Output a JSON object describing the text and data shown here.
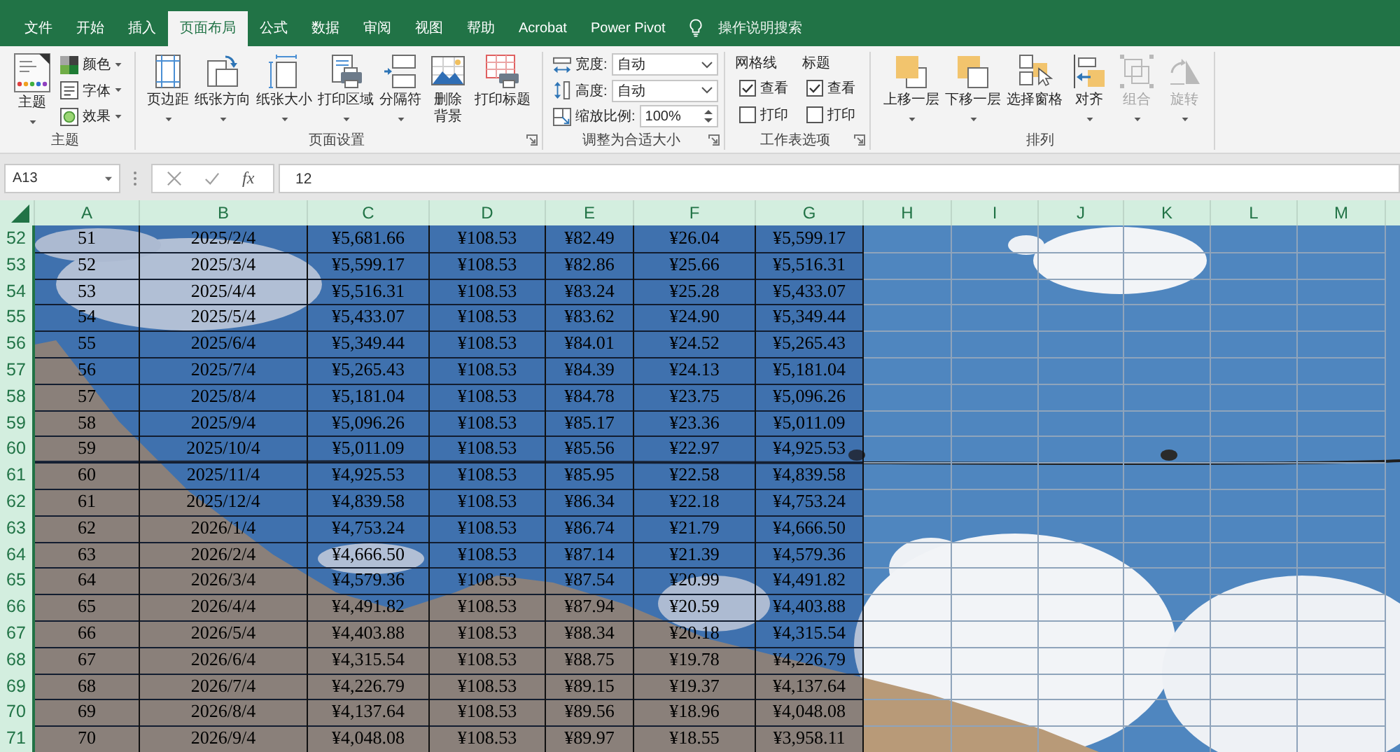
{
  "tabs": [
    {
      "label": "文件",
      "selected": false
    },
    {
      "label": "开始",
      "selected": false
    },
    {
      "label": "插入",
      "selected": false
    },
    {
      "label": "页面布局",
      "selected": true
    },
    {
      "label": "公式",
      "selected": false
    },
    {
      "label": "数据",
      "selected": false
    },
    {
      "label": "审阅",
      "selected": false
    },
    {
      "label": "视图",
      "selected": false
    },
    {
      "label": "帮助",
      "selected": false
    },
    {
      "label": "Acrobat",
      "selected": false
    },
    {
      "label": "Power Pivot",
      "selected": false
    }
  ],
  "tell_me": {
    "placeholder": "操作说明搜索"
  },
  "ribbon": {
    "groups": [
      {
        "kind": "gallery",
        "label": "主题",
        "launcher": false,
        "main": {
          "label": "主题",
          "dropdown": true
        },
        "options": [
          {
            "label": "颜色",
            "dropdown": true
          },
          {
            "label": "字体",
            "dropdown": true
          },
          {
            "label": "效果",
            "dropdown": true
          }
        ]
      },
      {
        "kind": "large_buttons",
        "label": "页面设置",
        "launcher": true,
        "buttons": [
          {
            "label": "页边距",
            "dropdown": true
          },
          {
            "label": "纸张方向",
            "dropdown": true
          },
          {
            "label": "纸张大小",
            "dropdown": true
          },
          {
            "label": "打印区域",
            "dropdown": true
          },
          {
            "label": "分隔符",
            "dropdown": true
          },
          {
            "label": "删除背景",
            "dropdown": false
          },
          {
            "label": "打印标题",
            "dropdown": false
          }
        ]
      },
      {
        "kind": "fields",
        "label": "调整为合适大小",
        "launcher": true,
        "fields": [
          {
            "label": "宽度:",
            "value": "自动",
            "kind": "dropdown"
          },
          {
            "label": "高度:",
            "value": "自动",
            "kind": "dropdown"
          },
          {
            "label": "缩放比例:",
            "value": "100%",
            "kind": "spinner"
          }
        ]
      },
      {
        "kind": "checkboxes",
        "label": "工作表选项",
        "launcher": true,
        "sections": [
          {
            "header": "网格线",
            "options": [
              {
                "label": "查看",
                "checked": true
              },
              {
                "label": "打印",
                "checked": false
              }
            ]
          },
          {
            "header": "标题",
            "options": [
              {
                "label": "查看",
                "checked": true
              },
              {
                "label": "打印",
                "checked": false
              }
            ]
          }
        ]
      },
      {
        "kind": "large_buttons",
        "label": "排列",
        "launcher": false,
        "buttons": [
          {
            "label": "上移一层",
            "dropdown": true,
            "disabled": false
          },
          {
            "label": "下移一层",
            "dropdown": true,
            "disabled": false
          },
          {
            "label": "选择窗格",
            "dropdown": false,
            "disabled": false
          },
          {
            "label": "对齐",
            "dropdown": true,
            "disabled": false
          },
          {
            "label": "组合",
            "dropdown": true,
            "disabled": true
          },
          {
            "label": "旋转",
            "dropdown": true,
            "disabled": true
          }
        ]
      }
    ]
  },
  "formula_bar": {
    "name_box": "A13",
    "function_label": "fx",
    "formula": "12"
  },
  "sheet": {
    "all_selected": true,
    "columns": [
      "A",
      "B",
      "C",
      "D",
      "E",
      "F",
      "G",
      "H",
      "I",
      "J",
      "K",
      "L",
      "M"
    ],
    "rows": [
      {
        "header": "52",
        "cells": [
          "51",
          "2025/2/4",
          "¥5,681.66",
          "¥108.53",
          "¥82.49",
          "¥26.04",
          "¥5,599.17"
        ]
      },
      {
        "header": "53",
        "cells": [
          "52",
          "2025/3/4",
          "¥5,599.17",
          "¥108.53",
          "¥82.86",
          "¥25.66",
          "¥5,516.31"
        ]
      },
      {
        "header": "54",
        "cells": [
          "53",
          "2025/4/4",
          "¥5,516.31",
          "¥108.53",
          "¥83.24",
          "¥25.28",
          "¥5,433.07"
        ]
      },
      {
        "header": "55",
        "cells": [
          "54",
          "2025/5/4",
          "¥5,433.07",
          "¥108.53",
          "¥83.62",
          "¥24.90",
          "¥5,349.44"
        ]
      },
      {
        "header": "56",
        "cells": [
          "55",
          "2025/6/4",
          "¥5,349.44",
          "¥108.53",
          "¥84.01",
          "¥24.52",
          "¥5,265.43"
        ]
      },
      {
        "header": "57",
        "cells": [
          "56",
          "2025/7/4",
          "¥5,265.43",
          "¥108.53",
          "¥84.39",
          "¥24.13",
          "¥5,181.04"
        ]
      },
      {
        "header": "58",
        "cells": [
          "57",
          "2025/8/4",
          "¥5,181.04",
          "¥108.53",
          "¥84.78",
          "¥23.75",
          "¥5,096.26"
        ]
      },
      {
        "header": "59",
        "cells": [
          "58",
          "2025/9/4",
          "¥5,096.26",
          "¥108.53",
          "¥85.17",
          "¥23.36",
          "¥5,011.09"
        ]
      },
      {
        "header": "60",
        "cells": [
          "59",
          "2025/10/4",
          "¥5,011.09",
          "¥108.53",
          "¥85.56",
          "¥22.97",
          "¥4,925.53"
        ]
      },
      {
        "header": "61",
        "cells": [
          "60",
          "2025/11/4",
          "¥4,925.53",
          "¥108.53",
          "¥85.95",
          "¥22.58",
          "¥4,839.58"
        ]
      },
      {
        "header": "62",
        "cells": [
          "61",
          "2025/12/4",
          "¥4,839.58",
          "¥108.53",
          "¥86.34",
          "¥22.18",
          "¥4,753.24"
        ]
      },
      {
        "header": "63",
        "cells": [
          "62",
          "2026/1/4",
          "¥4,753.24",
          "¥108.53",
          "¥86.74",
          "¥21.79",
          "¥4,666.50"
        ]
      },
      {
        "header": "64",
        "cells": [
          "63",
          "2026/2/4",
          "¥4,666.50",
          "¥108.53",
          "¥87.14",
          "¥21.39",
          "¥4,579.36"
        ]
      },
      {
        "header": "65",
        "cells": [
          "64",
          "2026/3/4",
          "¥4,579.36",
          "¥108.53",
          "¥87.54",
          "¥20.99",
          "¥4,491.82"
        ]
      },
      {
        "header": "66",
        "cells": [
          "65",
          "2026/4/4",
          "¥4,491.82",
          "¥108.53",
          "¥87.94",
          "¥20.59",
          "¥4,403.88"
        ]
      },
      {
        "header": "67",
        "cells": [
          "66",
          "2026/5/4",
          "¥4,403.88",
          "¥108.53",
          "¥88.34",
          "¥20.18",
          "¥4,315.54"
        ]
      },
      {
        "header": "68",
        "cells": [
          "67",
          "2026/6/4",
          "¥4,315.54",
          "¥108.53",
          "¥88.75",
          "¥19.78",
          "¥4,226.79"
        ]
      },
      {
        "header": "69",
        "cells": [
          "68",
          "2026/7/4",
          "¥4,226.79",
          "¥108.53",
          "¥89.15",
          "¥19.37",
          "¥4,137.64"
        ]
      },
      {
        "header": "70",
        "cells": [
          "69",
          "2026/8/4",
          "¥4,137.64",
          "¥108.53",
          "¥89.56",
          "¥18.96",
          "¥4,048.08"
        ]
      },
      {
        "header": "71",
        "cells": [
          "70",
          "2026/9/4",
          "¥4,048.08",
          "¥108.53",
          "¥89.97",
          "¥18.55",
          "¥3,958.11"
        ]
      }
    ]
  }
}
